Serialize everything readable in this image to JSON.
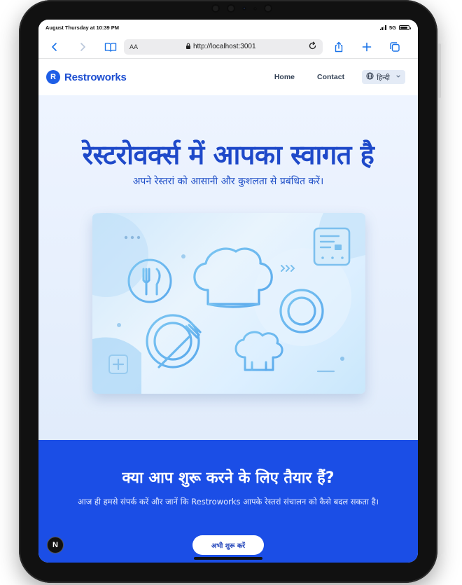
{
  "status_bar": {
    "datetime": "August Thursday at 10:39 PM",
    "network": "5G",
    "battery_level": 0.95
  },
  "browser": {
    "text_size_label": "AA",
    "url": "http://localhost:3001",
    "icons": [
      "back-icon",
      "forward-icon",
      "bookmarks-icon",
      "text-size-icon",
      "lock-icon",
      "reload-icon",
      "share-icon",
      "new-tab-icon",
      "tabs-icon"
    ]
  },
  "header": {
    "logo_letter": "R",
    "brand": "Restroworks",
    "nav": [
      {
        "label": "Home"
      },
      {
        "label": "Contact"
      }
    ],
    "language": "हिन्दी"
  },
  "hero": {
    "title": "रेस्टरोवर्क्स में आपका स्वागत है",
    "subtitle": "अपने रेस्तरां को आसानी और कुशलता से प्रबंधित करें।",
    "illustration_icons": [
      "chef-hat-icon",
      "fork-knife-icon",
      "plate-fork-icon",
      "plate-icon",
      "small-chef-hat-icon",
      "menu-card-icon",
      "plus-icon"
    ]
  },
  "cta": {
    "title": "क्या आप शुरू करने के लिए तैयार हैं?",
    "subtitle": "आज ही हमसे संपर्क करें और जानें कि Restroworks आपके रेस्तरां संचालन को कैसे बदल सकता है।",
    "button": "अभी शुरू करें"
  },
  "dev_badge": "N",
  "colors": {
    "brand": "#1e4fd1",
    "cta_bg": "#1b4ee6",
    "hero_text": "#1e49c9",
    "browser_accent": "#1a73e8"
  }
}
